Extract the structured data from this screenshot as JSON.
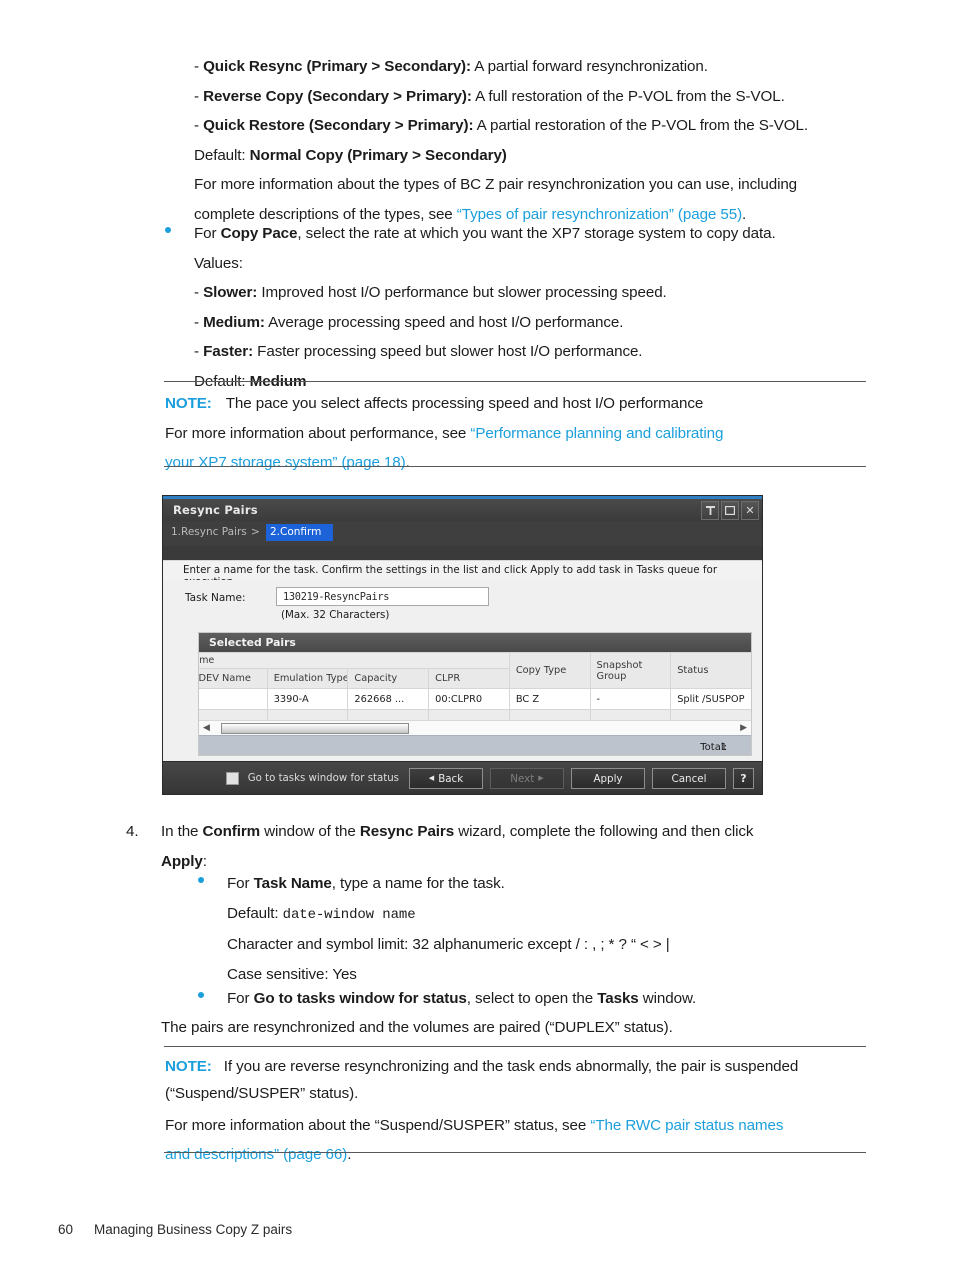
{
  "document": {
    "footer": {
      "page_number": "60",
      "chapter": "Managing Business Copy Z pairs"
    }
  },
  "section_resync_types": {
    "items": [
      {
        "dash": "-",
        "bold": "Quick Resync (Primary > Secondary):",
        "rest": " A partial forward resynchronization."
      },
      {
        "dash": "-",
        "bold": "Reverse Copy (Secondary > Primary):",
        "rest": " A full restoration of the P-VOL from the S-VOL."
      },
      {
        "dash": "-",
        "bold": "Quick Restore (Secondary > Primary):",
        "rest": " A partial restoration of the P-VOL from the S-VOL."
      }
    ],
    "default_label": "Default: ",
    "default_value": "Normal Copy (Primary > Secondary)",
    "more_info_line1": "For more information about the types of BC Z pair resynchronization you can use, including",
    "more_info_line2_pre": "complete descriptions of the types, see ",
    "more_info_link": "“Types of pair resynchronization” (page 55)",
    "more_info_line2_post": "."
  },
  "section_copy_pace": {
    "lead_pre": "For ",
    "lead_bold": "Copy Pace",
    "lead_post": ", select the rate at which you want the XP7 storage system to copy data.",
    "values_label": "Values:",
    "values": [
      {
        "dash": "-",
        "bold": "Slower:",
        "rest": " Improved host I/O performance but slower processing speed."
      },
      {
        "dash": "-",
        "bold": "Medium:",
        "rest": " Average processing speed and host I/O performance."
      },
      {
        "dash": "-",
        "bold": "Faster:",
        "rest": " Faster processing speed but slower host I/O performance."
      }
    ],
    "default_label": "Default: ",
    "default_value": "Medium"
  },
  "note_pace": {
    "label": "NOTE:",
    "text": "The pace you select affects processing speed and host I/O performance",
    "line2_pre": "For more information about performance, see ",
    "link_line1": "“Performance planning and calibrating",
    "link_line2": "your XP7 storage system” (page 18)",
    "line3_post": "."
  },
  "dialog": {
    "title": "Resync Pairs",
    "window_buttons": [
      {
        "icon": "pin-icon",
        "label": ""
      },
      {
        "icon": "maximize-icon",
        "label": ""
      },
      {
        "icon": "close-icon",
        "label": "✕"
      }
    ],
    "steps": {
      "step1": "1.Resync Pairs",
      "separator": ">",
      "step2": "2.Confirm"
    },
    "instruction": "Enter a name for the task. Confirm the settings in the list and click Apply to add task in Tasks queue for execution.",
    "task_name": {
      "label": "Task Name:",
      "value": "130219-ResyncPairs",
      "hint": "(Max. 32 Characters)"
    },
    "table": {
      "panel_title": "Selected Pairs",
      "group_header_clipped": "ume",
      "columns": [
        "LDEV Name",
        "Emulation Type",
        "Capacity",
        "CLPR",
        "Copy Type",
        "Snapshot Group",
        "Status"
      ],
      "columns_wrapped": [
        {
          "line1": "LDEV Name",
          "line2": ""
        },
        {
          "line1": "Emulation Type",
          "line2": ""
        },
        {
          "line1": "Capacity",
          "line2": ""
        },
        {
          "line1": "CLPR",
          "line2": ""
        },
        {
          "line1": "Copy Type",
          "line2": ""
        },
        {
          "line1": "Snapshot",
          "line2": "Group"
        },
        {
          "line1": "Status",
          "line2": ""
        }
      ],
      "rows": [
        {
          "ldev_name": "",
          "emulation_type": "3390-A",
          "capacity": "262668 ...",
          "clpr": "00:CLPR0",
          "copy_type": "BC Z",
          "snapshot_group": "-",
          "status": "Split /SUSPOP"
        }
      ],
      "total_label": "Total:",
      "total_value": "1"
    },
    "footer": {
      "checkbox_label": "Go to tasks window for status",
      "buttons": [
        {
          "name": "back",
          "label": "Back",
          "disabled": false
        },
        {
          "name": "next",
          "label": "Next",
          "disabled": true
        },
        {
          "name": "apply",
          "label": "Apply",
          "disabled": false
        },
        {
          "name": "cancel",
          "label": "Cancel",
          "disabled": false
        },
        {
          "name": "help",
          "label": "?",
          "disabled": false
        }
      ]
    }
  },
  "step4": {
    "number": "4.",
    "line1_a": "In the ",
    "line1_b": "Confirm",
    "line1_c": " window of the ",
    "line1_d": "Resync Pairs",
    "line1_e": " wizard, complete the following and then click",
    "line2_bold": "Apply",
    "line2_rest": ":",
    "task_name_bullet": {
      "pre": "For ",
      "bold": "Task Name",
      "post": ", type a name for the task."
    },
    "default_label": "Default: ",
    "default_value": "date-window name",
    "char_limit": "Character and symbol limit: 32 alphanumeric except / : , ; * ? “ < > |",
    "case_sensitive": "Case sensitive: Yes",
    "tasks_bullet": {
      "pre": "For ",
      "bold": "Go to tasks window for status",
      "mid": ", select to open the ",
      "bold2": "Tasks",
      "post": " window."
    },
    "result_text": "The pairs are resynchronized and the volumes are paired (“DUPLEX” status)."
  },
  "note_suspend": {
    "label": "NOTE:",
    "line1": "If you are reverse resynchronizing and the task ends abnormally, the pair is suspended",
    "line2": "(“Suspend/SUSPER” status).",
    "line3_pre": "For more information about the “Suspend/SUSPER” status, see ",
    "link_line1": "“The RWC pair status names",
    "link_line2": "and descriptions” (page 66)",
    "line4_post": "."
  },
  "colors": {
    "link": "#1b9fdc",
    "note_label": "#1b9fdc",
    "bullet": "#1b9fdc",
    "dialog_accent": "#2f7fc4",
    "step_active": "#1c62d8",
    "table_footer": "#bcc3cd"
  }
}
